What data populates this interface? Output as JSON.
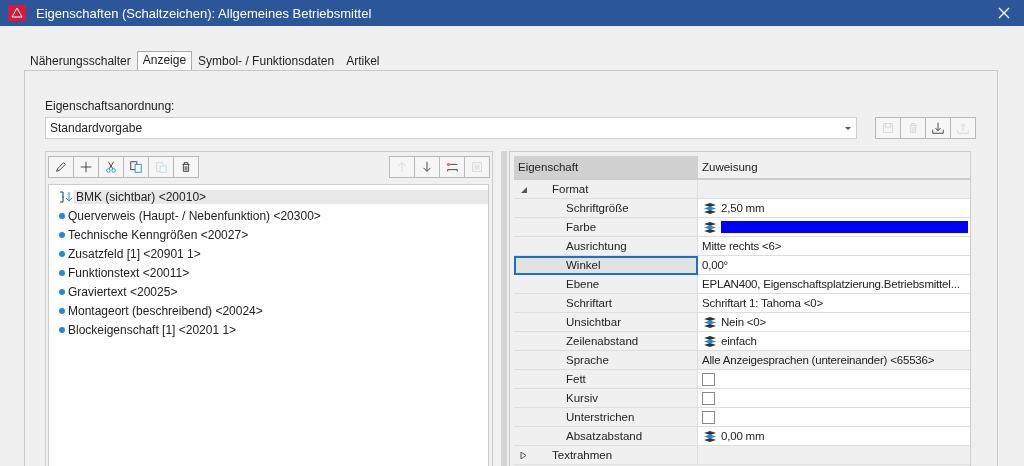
{
  "window": {
    "title": "Eigenschaften (Schaltzeichen): Allgemeines Betriebsmittel"
  },
  "tabs": [
    {
      "label": "Näherungsschalter",
      "selected": false
    },
    {
      "label": "Anzeige",
      "selected": true
    },
    {
      "label": "Symbol- / Funktionsdaten",
      "selected": false
    },
    {
      "label": "Artikel",
      "selected": false
    }
  ],
  "arrangement": {
    "label": "Eigenschaftsanordnung:",
    "value": "Standardvorgabe",
    "buttons": [
      {
        "kind": "save",
        "disabled": true
      },
      {
        "kind": "delete",
        "disabled": true
      },
      {
        "kind": "import",
        "disabled": false
      },
      {
        "kind": "export",
        "disabled": true
      }
    ]
  },
  "list_toolbar": [
    {
      "kind": "edit",
      "disabled": false
    },
    {
      "kind": "add",
      "disabled": false
    },
    {
      "kind": "cut",
      "disabled": false
    },
    {
      "kind": "copy",
      "disabled": false
    },
    {
      "kind": "paste",
      "disabled": true
    },
    {
      "kind": "delete",
      "disabled": false
    }
  ],
  "list_toolbar_right": [
    {
      "kind": "up",
      "disabled": true
    },
    {
      "kind": "down",
      "disabled": false
    },
    {
      "kind": "insert-line",
      "disabled": false
    },
    {
      "kind": "block",
      "disabled": true
    }
  ],
  "properties_list": [
    {
      "label": "BMK (sichtbar) <20010>",
      "kind": "anchor",
      "selected": true
    },
    {
      "label": "Querverweis (Haupt- / Nebenfunktion) <20300>",
      "kind": "entry",
      "selected": false
    },
    {
      "label": "Technische Kenngrößen <20027>",
      "kind": "entry",
      "selected": false
    },
    {
      "label": "Zusatzfeld [1] <20901 1>",
      "kind": "entry",
      "selected": false
    },
    {
      "label": "Funktionstext <20011>",
      "kind": "entry",
      "selected": false
    },
    {
      "label": "Graviertext <20025>",
      "kind": "entry",
      "selected": false
    },
    {
      "label": "Montageort (beschreibend) <20024>",
      "kind": "entry",
      "selected": false
    },
    {
      "label": "Blockeigenschaft [1] <20201 1>",
      "kind": "entry",
      "selected": false
    }
  ],
  "grid": {
    "columns": [
      "Eigenschaft",
      "Zuweisung"
    ],
    "groups": [
      {
        "label": "Format",
        "expanded": true,
        "rows": [
          {
            "name": "Schriftgröße",
            "kind": "text",
            "value": "2,50 mm",
            "layer_icon": true,
            "selected": false,
            "readonly": false
          },
          {
            "name": "Farbe",
            "kind": "color",
            "color": "#0000ff",
            "layer_icon": true,
            "selected": false,
            "readonly": false
          },
          {
            "name": "Ausrichtung",
            "kind": "text",
            "value": "Mitte rechts <6>",
            "layer_icon": false,
            "selected": false,
            "readonly": false
          },
          {
            "name": "Winkel",
            "kind": "text",
            "value": "0,00°",
            "layer_icon": false,
            "selected": true,
            "readonly": false
          },
          {
            "name": "Ebene",
            "kind": "text",
            "value": "EPLAN400, Eigenschaftsplatzierung.Betriebsmittel...",
            "layer_icon": false,
            "selected": false,
            "readonly": false
          },
          {
            "name": "Schriftart",
            "kind": "text",
            "value": "Schriftart 1: Tahoma <0>",
            "layer_icon": false,
            "selected": false,
            "readonly": false
          },
          {
            "name": "Unsichtbar",
            "kind": "text",
            "value": "Nein <0>",
            "layer_icon": true,
            "selected": false,
            "readonly": false
          },
          {
            "name": "Zeilenabstand",
            "kind": "text",
            "value": "einfach",
            "layer_icon": true,
            "selected": false,
            "readonly": false
          },
          {
            "name": "Sprache",
            "kind": "text",
            "value": "Alle Anzeigesprachen (untereinander) <65536>",
            "layer_icon": false,
            "selected": false,
            "readonly": true
          },
          {
            "name": "Fett",
            "kind": "checkbox",
            "checked": false,
            "layer_icon": false,
            "selected": false,
            "readonly": false
          },
          {
            "name": "Kursiv",
            "kind": "checkbox",
            "checked": false,
            "layer_icon": false,
            "selected": false,
            "readonly": false
          },
          {
            "name": "Unterstrichen",
            "kind": "checkbox",
            "checked": false,
            "layer_icon": false,
            "selected": false,
            "readonly": false
          },
          {
            "name": "Absatzabstand",
            "kind": "text",
            "value": "0,00 mm",
            "layer_icon": true,
            "selected": false,
            "readonly": false
          }
        ]
      },
      {
        "label": "Textrahmen",
        "expanded": false
      }
    ]
  }
}
